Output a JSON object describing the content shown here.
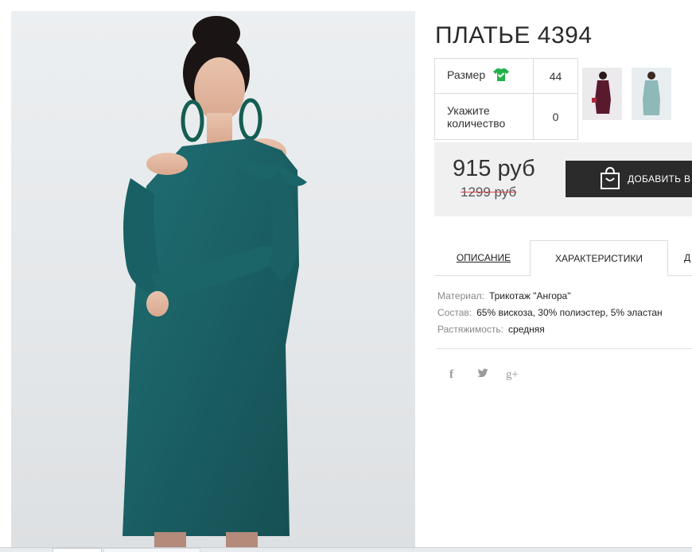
{
  "product": {
    "title": "ПЛАТЬЕ 4394"
  },
  "options": {
    "size_label": "Размер",
    "size_value": "44",
    "qty_label": "Укажите количество",
    "qty_value": "0"
  },
  "pricing": {
    "price": "915 руб",
    "old_price": "1299 руб",
    "add_button_label": "ДОБАВИТЬ В"
  },
  "tabs": [
    {
      "label": "ОПИСАНИЕ"
    },
    {
      "label": "ХАРАКТЕРИСТИКИ",
      "active": true
    },
    {
      "label": "Д"
    }
  ],
  "characteristics": [
    {
      "key": "Материал:",
      "value": "Трикотаж \"Ангора\""
    },
    {
      "key": "Состав:",
      "value": "65% вискоза, 30% полиэстер, 5% эластан"
    },
    {
      "key": "Растяжимость:",
      "value": "средняя"
    }
  ],
  "social": {
    "facebook": "f",
    "twitter": "🐦",
    "googleplus": "g+"
  },
  "icons": {
    "size_icon": "green-shirt-check-icon",
    "cart_icon": "shopping-bag-icon"
  },
  "colors": {
    "dress": "#1d6b6e",
    "button_bg": "#2b2b2b",
    "size_icon": "#22b14c",
    "strike": "#e04040"
  }
}
